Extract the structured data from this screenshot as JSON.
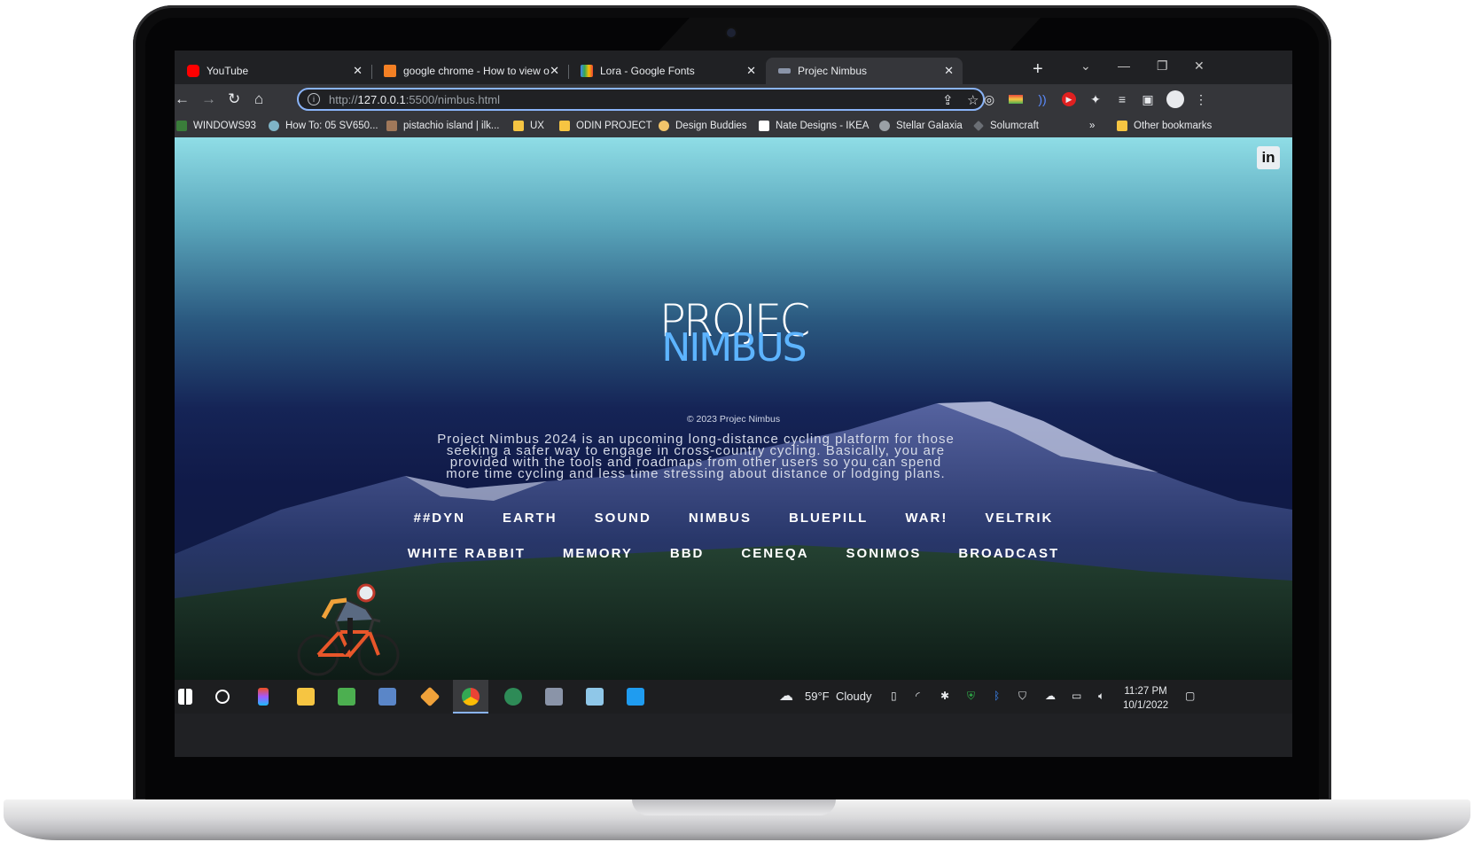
{
  "tabs": [
    {
      "title": "YouTube",
      "favicon": "youtube-icon",
      "color": "#ff0000"
    },
    {
      "title": "google chrome - How to view or",
      "favicon": "stackoverflow-icon",
      "color": "#f48024"
    },
    {
      "title": "Lora - Google Fonts",
      "favicon": "google-fonts-icon",
      "color": "#4285f4"
    },
    {
      "title": "Projec Nimbus",
      "favicon": "nimbus-icon",
      "color": "#8ab4f8",
      "active": true
    }
  ],
  "toolbar": {
    "url_host": "127.0.0.1",
    "url_prefix": "http://",
    "url_rest": ":5500/nimbus.html"
  },
  "bookmarks": [
    {
      "label": "WINDOWS93",
      "icon": "windows93-icon"
    },
    {
      "label": "How To: 05 SV650...",
      "icon": "bike-icon"
    },
    {
      "label": "pistachio island | ilk...",
      "icon": "image-icon"
    },
    {
      "label": "UX",
      "icon": "folder-icon"
    },
    {
      "label": "ODIN PROJECT",
      "icon": "folder-icon"
    },
    {
      "label": "Design Buddies",
      "icon": "design-icon"
    },
    {
      "label": "Nate Designs - IKEA",
      "icon": "nate-icon"
    },
    {
      "label": "Stellar Galaxia",
      "icon": "globe-icon"
    },
    {
      "label": "Solumcraft",
      "icon": "gem-icon"
    }
  ],
  "bookmarks_overflow": "»",
  "other_bookmarks": "Other bookmarks",
  "page": {
    "logo_top": "PROJEC",
    "logo_bottom": "NIMBUS",
    "copyright": "© 2023 Projec Nimbus",
    "description": "Project Nimbus 2024 is an upcoming long-distance cycling platform for those seeking a safer way to engage in cross-country cycling. Basically, you are provided with the tools and roadmaps from other users so you can spend more time cycling and less time stressing about distance or lodging plans.",
    "nav_row1": [
      "##DYN",
      "EARTH",
      "SOUND",
      "NIMBUS",
      "BLUEPILL",
      "WAR!",
      "VELTRIK"
    ],
    "nav_row2": [
      "WHITE RABBIT",
      "MEMORY",
      "BBD",
      "CENEQA",
      "SONIMOS",
      "BROADCAST"
    ],
    "linkedin_label": "in"
  },
  "taskbar": {
    "weather_temp": "59°F",
    "weather_desc": "Cloudy",
    "time": "11:27 PM",
    "date": "10/1/2022"
  }
}
